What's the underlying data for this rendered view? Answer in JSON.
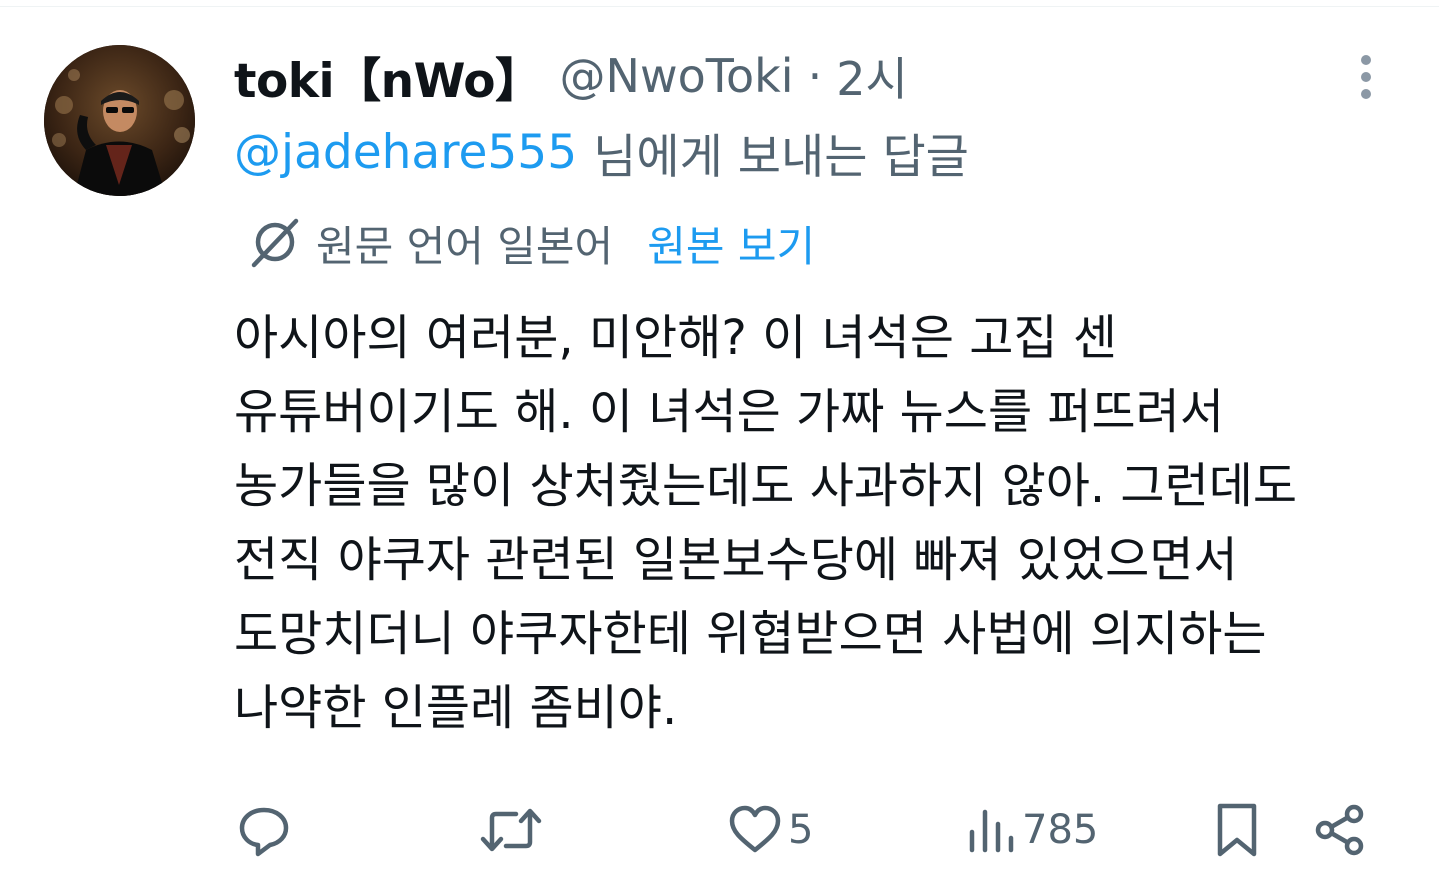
{
  "tweet": {
    "display_name": "toki【nWo】",
    "handle": "@NwoToki",
    "separator": "·",
    "time": "2시",
    "reply_to": {
      "mention": "@jadehare555",
      "suffix": "님에게 보내는 답글"
    },
    "translation": {
      "label": "원문 언어 일본어",
      "show_original": "원본 보기"
    },
    "text_lines": [
      "아시아의 여러분, 미안해? 이 녀석은 고집 센",
      "유튜버이기도 해. 이 녀석은 가짜 뉴스를 퍼뜨려서",
      "농가들을 많이 상처줬는데도 사과하지 않아. 그런데도",
      "전직 야쿠자 관련된 일본보수당에 빠져 있었으면서",
      "도망치더니 야쿠자한테 위협받으면 사법에 의지하는",
      "나약한 인플레 좀비야."
    ],
    "actions": {
      "reply_icon": "speech-bubble-icon",
      "retweet_icon": "retweet-arrows-icon",
      "like_icon": "heart-icon",
      "like_count": "5",
      "views_icon": "bar-chart-icon",
      "views_count": "785",
      "bookmark_icon": "bookmark-icon",
      "share_icon": "share-nodes-icon"
    }
  },
  "colors": {
    "accent": "#1d9bf0",
    "text_primary": "#0f1419",
    "text_secondary": "#536471"
  }
}
